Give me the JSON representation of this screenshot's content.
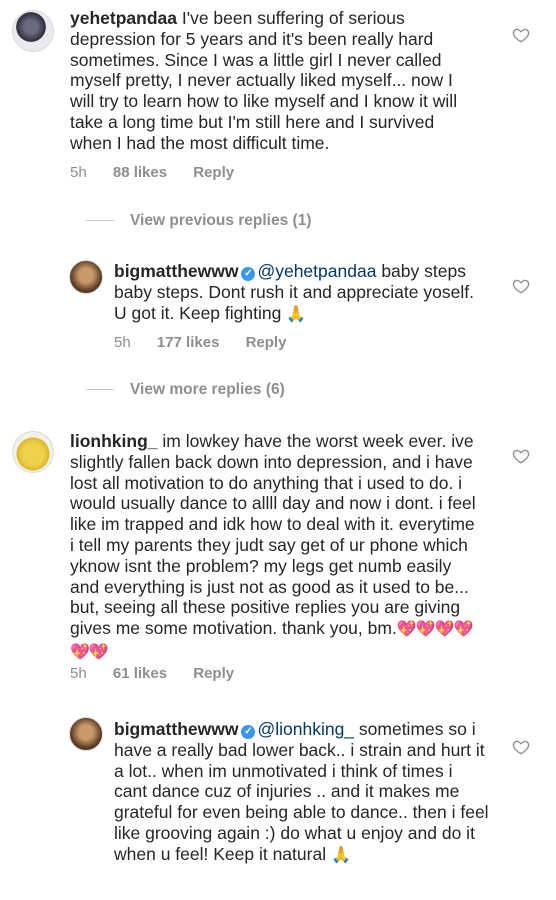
{
  "comments": [
    {
      "username": "yehetpandaa",
      "text": "I've been suffering of serious depression for 5 years and it's been really hard sometimes. Since I was a little girl I never called myself pretty, I never actually liked myself... now I will try to learn how to like myself and I know it will take a long time but I'm still here and I survived when I had the most difficult time.",
      "time": "5h",
      "likes": "88 likes",
      "reply": "Reply"
    },
    {
      "username": "bigmatthewww",
      "mention": "@yehetpandaa",
      "text": "baby steps baby steps. Dont rush it and appreciate yoself. U got it. Keep fighting",
      "emoji": "🙏",
      "time": "5h",
      "likes": "177 likes",
      "reply": "Reply"
    },
    {
      "username": "lionhking_",
      "text": "im lowkey have the worst week ever. ive slightly fallen back down into depression, and i have lost all motivation to do anything that i used to do. i would usually dance to allll day and now i dont. i feel like im trapped and idk how to deal with it. everytime i tell my parents they judt say get of ur phone which yknow isnt the problem? my legs get numb easily and everything is just not as good as it used to be... but, seeing all these positive replies you are giving gives me some motivation. thank you, bm.",
      "emoji": "💖💖💖💖💖💖",
      "time": "5h",
      "likes": "61 likes",
      "reply": "Reply"
    },
    {
      "username": "bigmatthewww",
      "mention": "@lionhking_",
      "text": "sometimes so i have a really bad lower back.. i strain and hurt it a lot.. when im unmotivated i think of times i cant dance cuz of injuries .. and it makes me grateful for even being able to dance.. then i feel like grooving again :) do what u enjoy and do it when u feel! Keep it natural",
      "emoji": "🙏"
    }
  ],
  "view_previous": "View previous replies (1)",
  "view_more": "View more replies (6)",
  "icons": {
    "verified": "verified-badge-icon",
    "heart": "heart-outline-icon"
  },
  "colors": {
    "text": "#262626",
    "meta": "#8e8e8e",
    "mention": "#00376b",
    "verified": "#3897f0"
  }
}
